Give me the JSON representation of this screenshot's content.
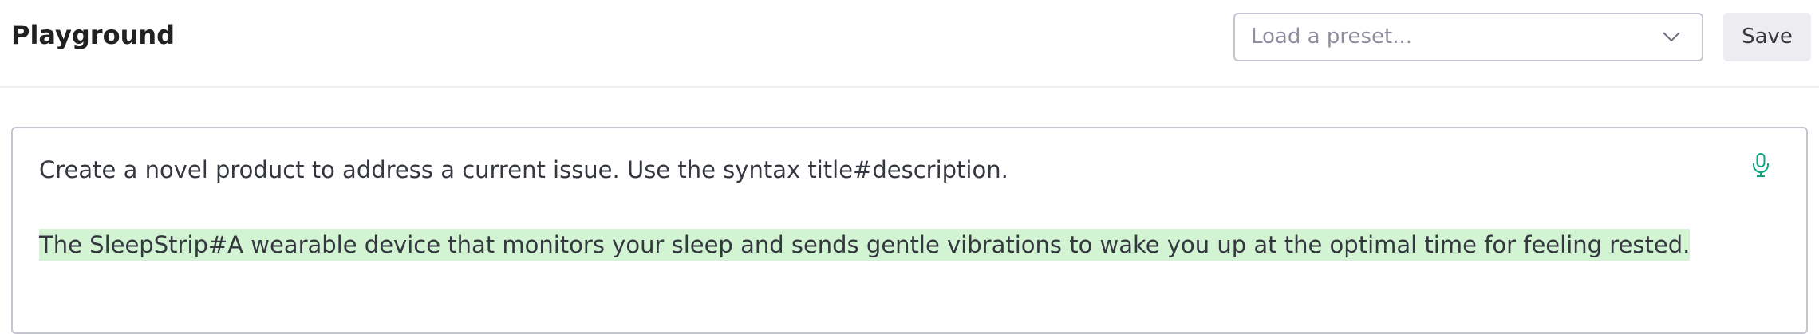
{
  "header": {
    "title": "Playground",
    "preset_placeholder": "Load a preset...",
    "save_label": "Save"
  },
  "editor": {
    "prompt": "Create a novel product to address a current issue. Use the syntax title#description.",
    "completion": "The SleepStrip#A wearable device that monitors your sleep and sends gentle vibrations to wake you up at the optimal time for feeling rested."
  },
  "icons": {
    "preset_dropdown": "chevron-down-icon",
    "voice_input": "microphone-icon"
  },
  "colors": {
    "completion_highlight": "#d2f4d3",
    "mic_accent": "#10a37f"
  }
}
